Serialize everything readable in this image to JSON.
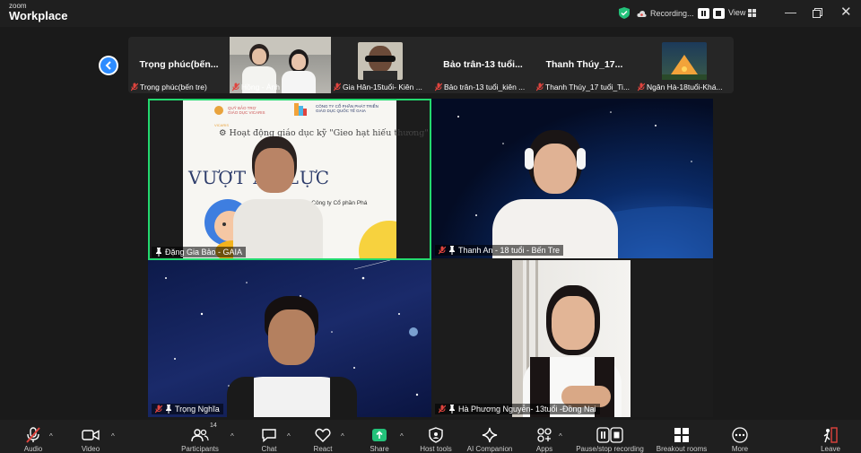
{
  "app": {
    "logo_small": "zoom",
    "logo_big": "Workplace",
    "recording_label": "Recording...",
    "view_label": "View"
  },
  "filmstrip": [
    {
      "display_name": "Trọng phúc(bến...",
      "label": "Trọng phúc(bến tre)"
    },
    {
      "display_name": "",
      "label": "Hồng - Ánh"
    },
    {
      "display_name": "",
      "label": "Gia Hân-15tuổi- Kiên ..."
    },
    {
      "display_name": "Bảo trân-13 tuổi...",
      "label": "Bảo trân-13 tuổi_kiên ..."
    },
    {
      "display_name": "Thanh Thúy_17...",
      "label": "Thanh Thúy_17 tuổi_Ti..."
    },
    {
      "display_name": "",
      "label": "Ngân Hà-18tuổi-Khá..."
    }
  ],
  "grid": [
    {
      "label": "Đặng Gia Bảo - GAIA",
      "muted": false
    },
    {
      "label": "Thanh An - 18 tuổi - Bến Tre",
      "muted": true
    },
    {
      "label": "Trọng Nghĩa",
      "muted": true
    },
    {
      "label": "Hà Phương Nguyễn- 13tuổi -Đồng Nai",
      "muted": true
    }
  ],
  "slide": {
    "sponsor_left": "QUỸ BẢO TRỢ\nGIÁO DỤC VICARIS",
    "sponsor_right": "CÔNG TY CỔ PHẦN PHÁT TRIỂN\nGIÁO DỤC QUỐC TẾ GAIA",
    "subtitle": "Hoạt động giáo dục kỹ \"Gieo hạt hiếu thương\"",
    "title": "VƯỢT         ÁP LỰC",
    "body": "huyên viên Công ty Cổ phần Phá\n tế GAIA",
    "logo_text": "VICARIS"
  },
  "toolbar": {
    "audio": "Audio",
    "video": "Video",
    "participants": "Participants",
    "participant_count": "14",
    "chat": "Chat",
    "react": "React",
    "share": "Share",
    "host_tools": "Host tools",
    "ai_companion": "AI Companion",
    "apps": "Apps",
    "pause_stop": "Pause/stop recording",
    "breakout": "Breakout rooms",
    "more": "More",
    "leave": "Leave"
  },
  "colors": {
    "active_speaker": "#23d96f",
    "accent": "#2d8cff",
    "share_green": "#23c27a",
    "muted_red": "#e0443e",
    "shield_green": "#23c27a"
  }
}
